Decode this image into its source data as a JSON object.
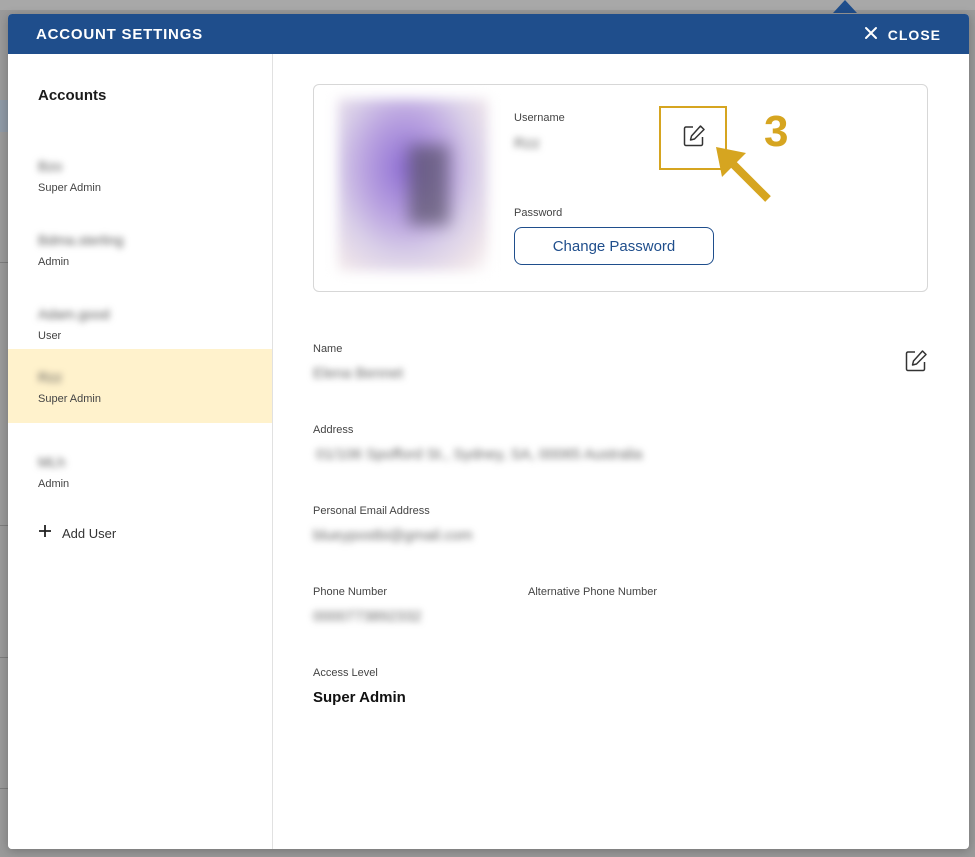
{
  "modal": {
    "title": "ACCOUNT SETTINGS",
    "close_label": "CLOSE",
    "header_color": "#1f4e8c"
  },
  "sidebar": {
    "heading": "Accounts",
    "items": [
      {
        "name": "Bzo",
        "role": "Super Admin",
        "selected": false
      },
      {
        "name": "Bdma.sterling",
        "role": "Admin",
        "selected": false
      },
      {
        "name": "Adam.good",
        "role": "User",
        "selected": false
      },
      {
        "name": "Rzz",
        "role": "Super Admin",
        "selected": true
      },
      {
        "name": "MLh",
        "role": "Admin",
        "selected": false
      }
    ],
    "add_user_label": "Add User"
  },
  "profile": {
    "username_label": "Username",
    "username_value": "Rzz",
    "password_label": "Password",
    "change_password_label": "Change Password"
  },
  "annotation": {
    "step_number": "3",
    "color": "#d6a520"
  },
  "details": {
    "name_label": "Name",
    "name_value": "Elena Bennet",
    "address_label": "Address",
    "address_value": "01/106 Spofford St., Sydney, SA, 00065 Australia",
    "email_label": "Personal Email Address",
    "email_value": "blueypostbi@gmail.com",
    "phone_label": "Phone Number",
    "phone_value": "0000773892332",
    "alt_phone_label": "Alternative Phone Number",
    "access_label": "Access Level",
    "access_value": "Super Admin"
  },
  "icons": {
    "close": "close-icon",
    "edit": "edit-icon",
    "add": "plus-icon",
    "arrow": "arrow-icon"
  },
  "colors": {
    "accent": "#1f4e8c",
    "selected_bg": "#fff2cc",
    "highlight": "#d6a520"
  }
}
